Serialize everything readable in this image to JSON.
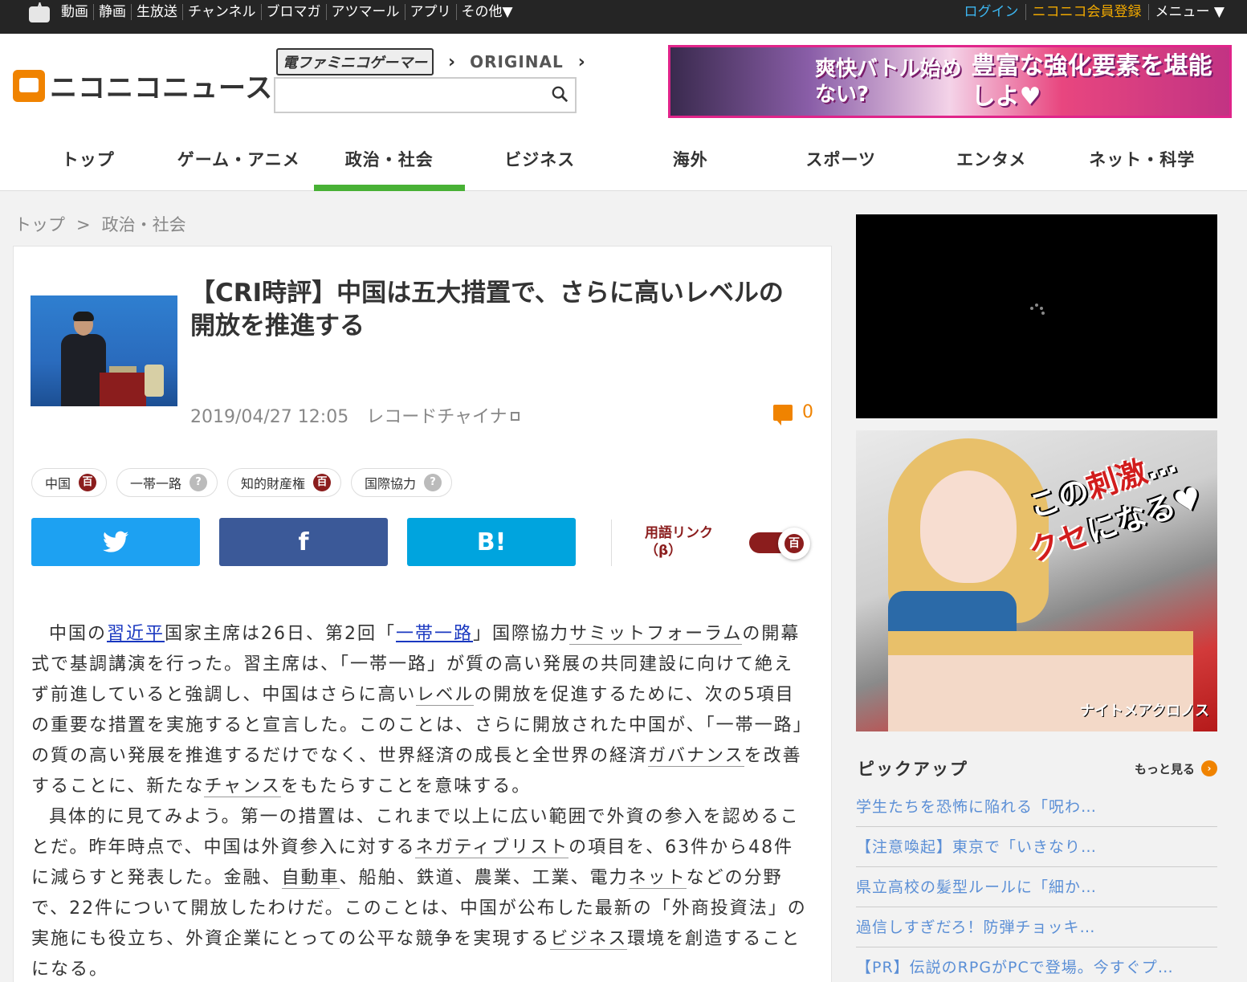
{
  "topbar": {
    "nav": [
      "動画",
      "静画",
      "生放送",
      "チャンネル",
      "ブロマガ",
      "アツマール",
      "アプリ",
      "その他▼"
    ],
    "login": "ログイン",
    "register": "ニコニコ会員登録",
    "menu": "メニュー ▼",
    "colors": {
      "login": "#3db6f0",
      "register": "#f0a800"
    }
  },
  "header": {
    "logo_text": "ニコニコニュース",
    "famitsu_label": "電ファミニコゲーマー",
    "original_label": "ORIGINAL",
    "search_placeholder": "",
    "ad_left": "爽快バトル始めない?",
    "ad_right": "豊富な強化要素を堪能しよ♥",
    "categories": [
      "トップ",
      "ゲーム・アニメ",
      "政治・社会",
      "ビジネス",
      "海外",
      "スポーツ",
      "エンタメ",
      "ネット・科学"
    ],
    "active_category": 2
  },
  "breadcrumb": {
    "home": "トップ",
    "sep": ">",
    "current": "政治・社会"
  },
  "article": {
    "title": "【CRI時評】中国は五大措置で、さらに高いレベルの開放を推進する",
    "date": "2019/04/27 12:05",
    "source": "レコードチャイナ",
    "comment_count": "0",
    "tags": [
      {
        "label": "中国",
        "icon": "百"
      },
      {
        "label": "一帯一路",
        "icon": "?"
      },
      {
        "label": "知的財産権",
        "icon": "百"
      },
      {
        "label": "国際協力",
        "icon": "?"
      }
    ],
    "share": {
      "twitter": "twitter-icon",
      "facebook": "f",
      "hatena": "B!"
    },
    "term_link_label": "用語リンク",
    "term_link_beta": "（β）",
    "toggle_icon": "百"
  },
  "body": {
    "p1_a": "中国の",
    "p1_link1": "習近平",
    "p1_b": "国家主席は26日、第2回「",
    "p1_link2": "一帯一路",
    "p1_c": "」国際協力",
    "p1_u1": "サミット",
    "p1_u2": "フォーラム",
    "p1_d": "の開幕式で基調講演を行った。習主席は、「一帯一路」が質の高い発展の共同建設に向けて絶えず前進していると強調し、中国はさらに高い",
    "p1_u3": "レベル",
    "p1_e": "の開放を促進するために、次の5項目の重要な措置を実施すると宣言した。このことは、さらに開放された中国が、「一帯一路」の質の高い発展を推進するだけでなく、世界経済の成長と全世界の経済",
    "p1_u4": "ガバナンス",
    "p1_f": "を改善することに、新たな",
    "p1_u5": "チャンス",
    "p1_g": "をもたらすことを意味する。",
    "p2_a": "具体的に見てみよう。第一の措置は、これまで以上に広い範囲で外資の参入を認めることだ。昨年時点で、中国は外資参入に対する",
    "p2_u1": "ネガティブリスト",
    "p2_b": "の項目を、63件から48件に減らすと発表した。金融、",
    "p2_u2": "自動車",
    "p2_c": "、船舶、鉄道、農業、工業、電力",
    "p2_u3": "ネット",
    "p2_d": "などの分野で、22件について開放したわけだ。このことは、中国が公布した最新の「外商投資法」の実施にも役立ち、外資企業にとっての公平な競争を実現する",
    "p2_u4": "ビジネス",
    "p2_e": "環境を創造することになる。"
  },
  "sidebar": {
    "ad_catch_1": "この",
    "ad_catch_red1": "刺激",
    "ad_catch_2": "…",
    "ad_catch_red2": "クセ",
    "ad_catch_3": "になる♥",
    "ad_brand": "ナイトメアクロノス",
    "pickup_title": "ピックアップ",
    "more_label": "もっと見る",
    "pickup_items": [
      "学生たちを恐怖に陥れる「呪わ…",
      "【注意喚起】東京で「いきなり…",
      "県立高校の髪型ルールに「細か…",
      "過信しすぎだろ！防弾チョッキ…",
      "【PR】伝説のRPGがPCで登場。今すぐプ…"
    ]
  },
  "colors": {
    "accent_green": "#48b135",
    "brand_orange": "#f08300",
    "dic_red": "#8b1d1d",
    "twitter": "#1da1f2",
    "facebook": "#3b5998",
    "hatena": "#00a4de"
  }
}
